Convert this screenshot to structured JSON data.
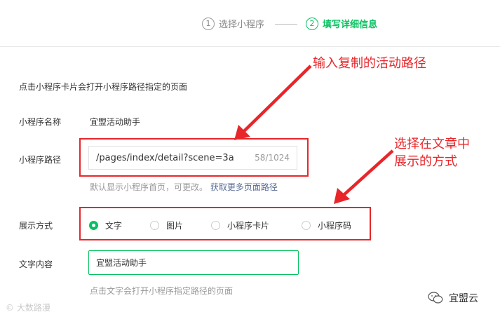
{
  "stepper": {
    "step1_num": "1",
    "step1_label": "选择小程序",
    "step2_num": "2",
    "step2_label": "填写详细信息",
    "active_color": "#07c160"
  },
  "form": {
    "description": "点击小程序卡片会打开小程序路径指定的页面",
    "name_label": "小程序名称",
    "name_value": "宜盟活动助手",
    "path_label": "小程序路径",
    "path_value": "/pages/index/detail?scene=3a",
    "path_counter": "58/1024",
    "path_hint": "默认显示小程序首页，可更改。",
    "path_hint_link": "获取更多页面路径",
    "display_label": "展示方式",
    "display_options": [
      "文字",
      "图片",
      "小程序卡片",
      "小程序码"
    ],
    "display_selected": "文字",
    "text_label": "文字内容",
    "text_value": "宜盟活动助手",
    "text_hint": "点击文字会打开小程序指定路径的页面"
  },
  "annotations": {
    "top": "输入复制的活动路径",
    "bottom_line1": "选择在文章中",
    "bottom_line2": "展示的方式",
    "color": "#e8262a"
  },
  "watermarks": {
    "left": "© 大数路漫",
    "right": "宜盟云",
    "right_icon": "wechat-icon"
  }
}
